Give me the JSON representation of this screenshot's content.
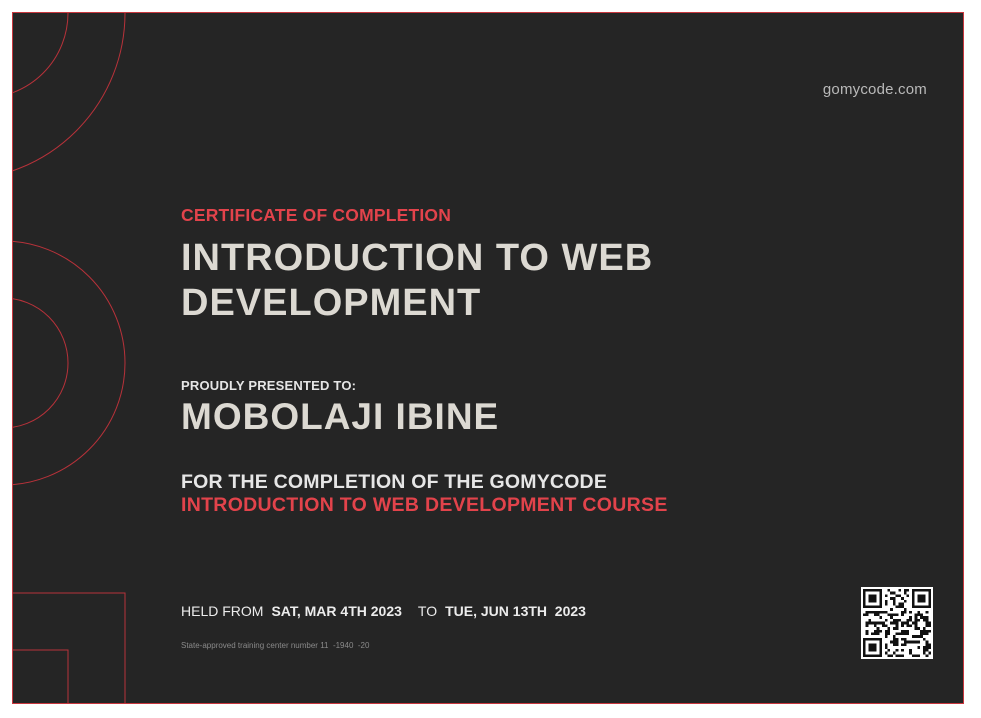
{
  "header": {
    "website": "gomycode.com"
  },
  "certificate": {
    "kicker": "CERTIFICATE OF COMPLETION",
    "course_title_line1": "INTRODUCTION TO WEB",
    "course_title_line2": "DEVELOPMENT",
    "presented_label": "PROUDLY PRESENTED TO:",
    "recipient": "MOBOLAJI IBINE",
    "completion_line1": "FOR THE COMPLETION OF THE GOMYCODE",
    "completion_line2": "INTRODUCTION TO WEB DEVELOPMENT COURSE"
  },
  "dates": {
    "held_label": "HELD FROM",
    "start_date": "SAT, MAR 4TH 2023",
    "to_label": "TO",
    "end_date": "TUE, JUN 13TH  2023"
  },
  "footer": {
    "note": "State-approved training center number 11  -1940  -20"
  },
  "colors": {
    "background": "#252525",
    "accent": "#e2434b",
    "title": "#dcd9d2"
  },
  "icons": {
    "qr": "qr-code-icon"
  }
}
